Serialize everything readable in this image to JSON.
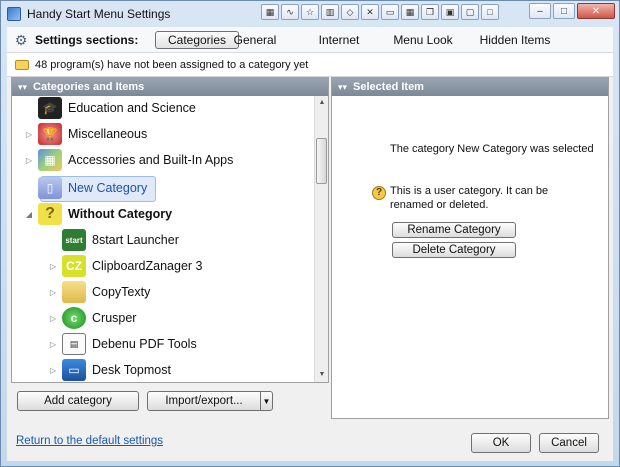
{
  "window": {
    "title": "Handy Start Menu Settings"
  },
  "toolbar_icons": [
    "grid-icon",
    "graph-icon",
    "star-icon",
    "bar-chart-icon",
    "node-icon",
    "x-tool-icon",
    "screen-icon",
    "grid-small-icon",
    "copy-icon",
    "tile-icon",
    "monitor-icon",
    "square-icon"
  ],
  "sections": {
    "label": "Settings sections:",
    "tabs": [
      "Categories",
      "General",
      "Internet",
      "Menu Look",
      "Hidden Items"
    ],
    "active": "Categories"
  },
  "info": {
    "text": "48 program(s) have not been assigned to a category yet"
  },
  "left_panel": {
    "header": "Categories and Items",
    "items": [
      {
        "label": "Education and Science",
        "icon": "graduation-cap-icon",
        "bold": false
      },
      {
        "label": "Miscellaneous",
        "icon": "trophy-icon",
        "bold": false
      },
      {
        "label": "Accessories and Built-In Apps",
        "icon": "apps-grid-icon",
        "bold": false
      },
      {
        "label": "New Category",
        "icon": "book-icon",
        "bold": false,
        "selected": true
      },
      {
        "label": "Without Category",
        "icon": "question-icon",
        "bold": true
      },
      {
        "label": "8start Launcher",
        "icon": "8start-icon",
        "bold": false
      },
      {
        "label": "ClipboardZanager 3",
        "icon": "cz-icon",
        "bold": false
      },
      {
        "label": "CopyTexty",
        "icon": "folder-icon",
        "bold": false
      },
      {
        "label": "Crusper",
        "icon": "crusper-icon",
        "bold": false
      },
      {
        "label": "Debenu PDF Tools",
        "icon": "pdf-doc-icon",
        "bold": false
      },
      {
        "label": "Desk Topmost",
        "icon": "desktop-icon",
        "bold": false
      }
    ],
    "add_button": "Add category",
    "import_button": "Import/export...",
    "cz_icon_text": "CZ",
    "start_icon_text": "start"
  },
  "right_panel": {
    "header": "Selected Item",
    "selected_text": "The category New Category was selected",
    "user_cat_text": "This is a user category. It can be renamed or deleted.",
    "rename_button": "Rename Category",
    "delete_button": "Delete Category"
  },
  "footer": {
    "reset_link": "Return to the default settings",
    "ok": "OK",
    "cancel": "Cancel"
  }
}
